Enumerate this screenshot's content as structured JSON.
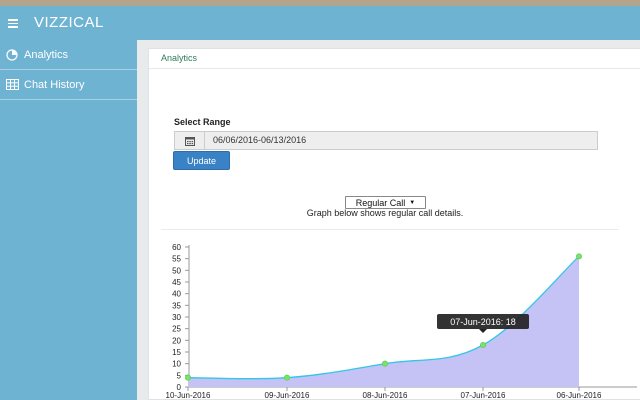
{
  "app": {
    "title": "VIZZICAL"
  },
  "topbar": {
    "menu_icon": "hamburger-menu-icon"
  },
  "sidebar": {
    "items": [
      {
        "label": "Analytics",
        "icon": "pie-chart-icon"
      },
      {
        "label": "Chat History",
        "icon": "table-grid-icon"
      }
    ]
  },
  "breadcrumb": {
    "label": "Analytics"
  },
  "range": {
    "label": "Select Range",
    "value": "06/06/2016-06/13/2016",
    "icon": "calendar-icon"
  },
  "update_button": {
    "label": "Update"
  },
  "call_type_select": {
    "selected": "Regular Call"
  },
  "graph_description": "Graph below shows regular call details.",
  "colors": {
    "accent": "#6fb3d2",
    "area_fill": "#c5c2f5",
    "line": "#34c6e6",
    "point": "#7be36b",
    "button": "#3a82c6"
  },
  "chart_data": {
    "type": "area",
    "x": [
      "10-Jun-2016",
      "09-Jun-2016",
      "08-Jun-2016",
      "07-Jun-2016",
      "06-Jun-2016"
    ],
    "values": [
      4,
      4,
      10,
      18,
      56
    ],
    "ylim": [
      0,
      60
    ],
    "yticks": [
      0,
      5,
      10,
      15,
      20,
      25,
      30,
      35,
      40,
      45,
      50,
      55,
      60
    ],
    "grid": false,
    "tooltip": {
      "text": "07-Jun-2016: 18"
    }
  }
}
